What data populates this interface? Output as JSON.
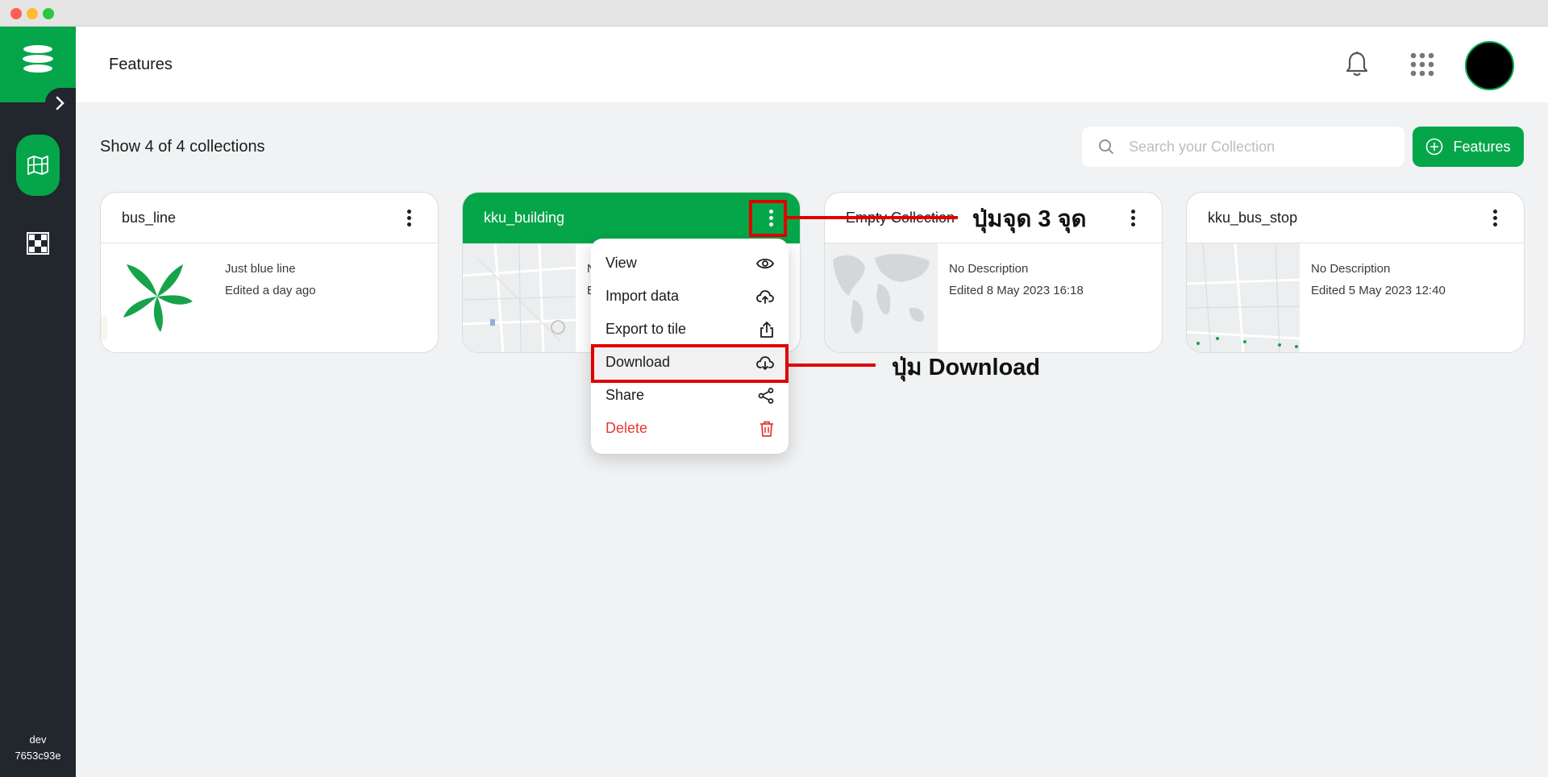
{
  "header": {
    "title": "Features"
  },
  "sidebar": {
    "env_label": "dev",
    "env_build": "7653c93e"
  },
  "toolbar": {
    "count_text": "Show 4 of 4 collections",
    "search_placeholder": "Search your Collection",
    "add_button_label": "Features"
  },
  "cards": [
    {
      "name": "bus_line",
      "description": "Just blue line",
      "edited": "Edited a day ago"
    },
    {
      "name": "kku_building",
      "description": "N",
      "edited": "E"
    },
    {
      "name": "Empty Collection",
      "description": "No Description",
      "edited": "Edited 8 May 2023 16:18"
    },
    {
      "name": "kku_bus_stop",
      "description": "No Description",
      "edited": "Edited 5 May 2023 12:40"
    }
  ],
  "menu": {
    "items": [
      {
        "label": "View",
        "icon": "eye-icon"
      },
      {
        "label": "Import data",
        "icon": "cloud-upload-icon"
      },
      {
        "label": "Export to tile",
        "icon": "share-upload-icon"
      },
      {
        "label": "Download",
        "icon": "cloud-download-icon"
      },
      {
        "label": "Share",
        "icon": "share-nodes-icon"
      },
      {
        "label": "Delete",
        "icon": "trash-icon"
      }
    ]
  },
  "annotations": {
    "kebab_label": "ปุ่มจุด 3 จุด",
    "download_label": "ปุ่ม Download"
  },
  "colors": {
    "brand_green": "#05a64a",
    "sidebar_dark": "#22262d",
    "danger_red": "#e53935",
    "annotation_red": "#e00000"
  }
}
